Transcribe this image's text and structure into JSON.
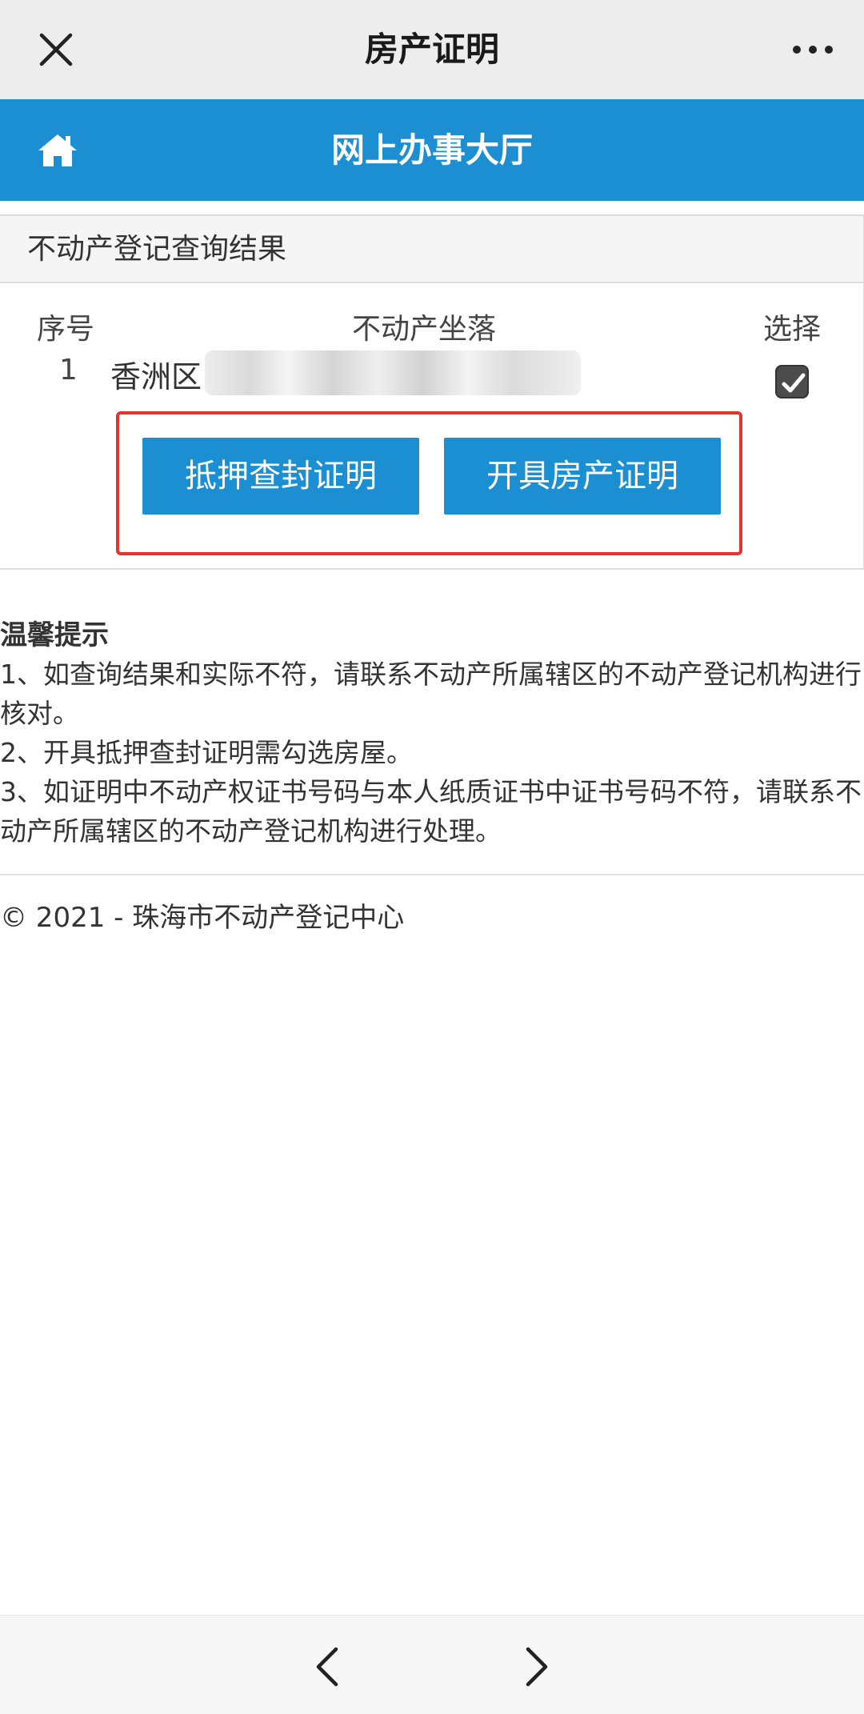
{
  "topbar": {
    "title": "房产证明"
  },
  "header": {
    "title": "网上办事大厅"
  },
  "panel": {
    "heading": "不动产登记查询结果",
    "columns": {
      "index": "序号",
      "location": "不动产坐落",
      "select": "选择"
    },
    "rows": [
      {
        "index": "1",
        "location": "香洲区",
        "selected": true
      }
    ]
  },
  "actions": {
    "mortgage_button": "抵押查封证明",
    "issue_button": "开具房产证明"
  },
  "tips": {
    "heading": "温馨提示",
    "items": [
      "1、如查询结果和实际不符，请联系不动产所属辖区的不动产登记机构进行核对。",
      "2、开具抵押查封证明需勾选房屋。",
      "3、如证明中不动产权证书号码与本人纸质证书中证书号码不符，请联系不动产所属辖区的不动产登记机构进行处理。"
    ]
  },
  "footer": {
    "text": "© 2021 - 珠海市不动产登记中心"
  },
  "colors": {
    "brand": "#1b8fd2",
    "highlight": "#e5322d"
  }
}
